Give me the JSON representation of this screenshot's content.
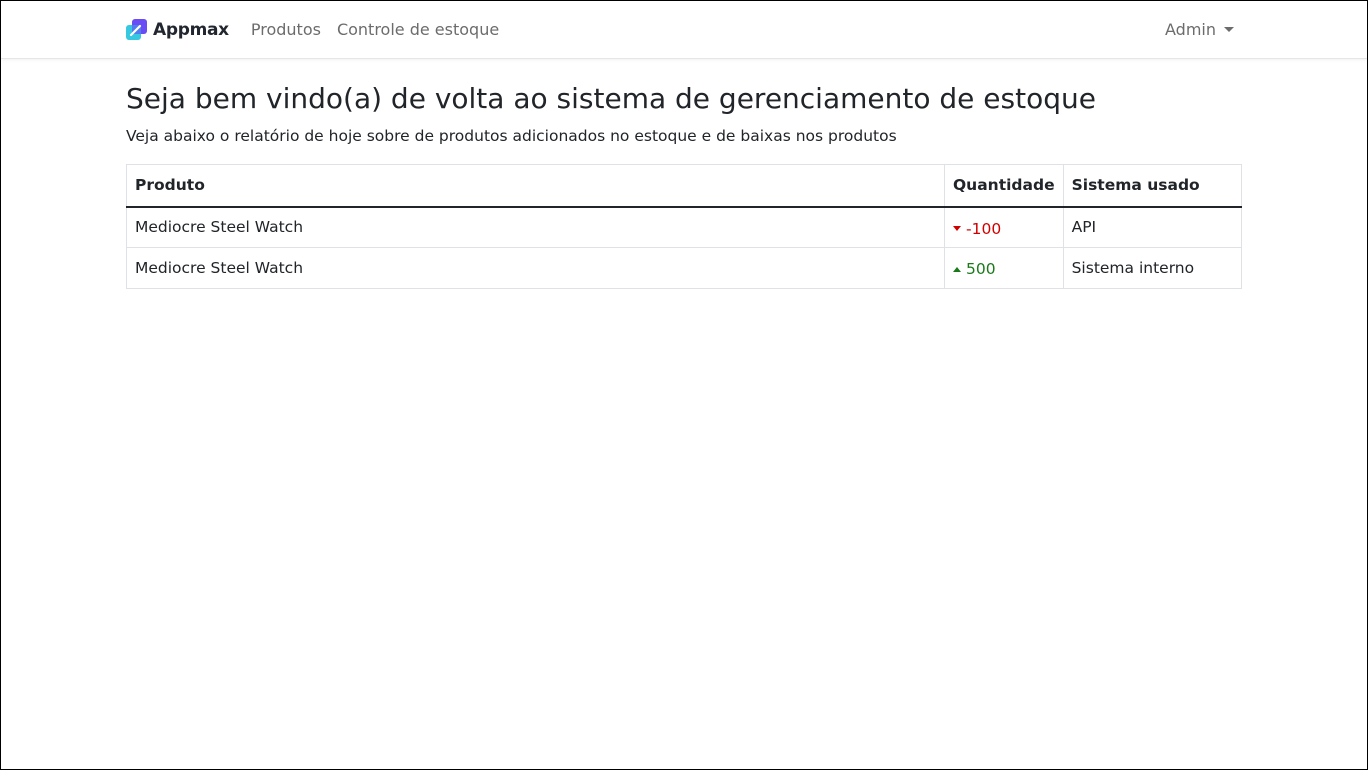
{
  "navbar": {
    "brand": "Appmax",
    "links": [
      "Produtos",
      "Controle de estoque"
    ],
    "user_menu": "Admin"
  },
  "main": {
    "title": "Seja bem vindo(a) de volta ao sistema de gerenciamento de estoque",
    "subtitle": "Veja abaixo o relatório de hoje sobre de produtos adicionados no estoque e de baixas nos produtos"
  },
  "table": {
    "headers": [
      "Produto",
      "Quantidade",
      "Sistema usado"
    ],
    "rows": [
      {
        "produto": "Mediocre Steel Watch",
        "quantidade": "-100",
        "direction": "down",
        "sistema": "API"
      },
      {
        "produto": "Mediocre Steel Watch",
        "quantidade": "500",
        "direction": "up",
        "sistema": "Sistema interno"
      }
    ]
  },
  "colors": {
    "brand_purple": "#6a4cf5",
    "brand_cyan": "#35c8e0",
    "decrease": "#d00000",
    "increase": "#1a7a1a"
  }
}
